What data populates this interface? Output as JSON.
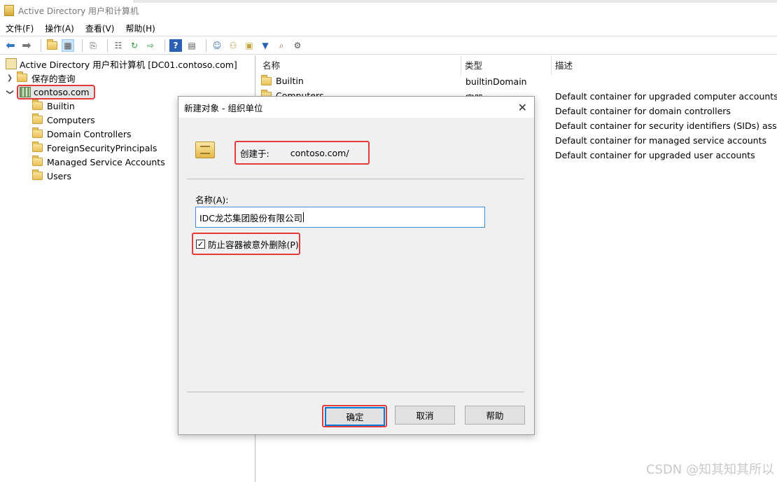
{
  "window": {
    "title": "Active Directory 用户和计算机"
  },
  "menu": [
    "文件(F)",
    "操作(A)",
    "查看(V)",
    "帮助(H)"
  ],
  "toolbar": [
    "back-icon",
    "forward-icon",
    "up-folder-icon",
    "console-tree-icon",
    "copy-icon",
    "properties-icon",
    "refresh-icon",
    "export-icon",
    "help-icon",
    "show-hide-icon",
    "new-user-icon",
    "new-group-icon",
    "new-ou-icon",
    "filter-icon",
    "find-icon",
    "delegate-icon"
  ],
  "tree": {
    "root": "Active Directory 用户和计算机 [DC01.contoso.com]",
    "saved_queries": "保存的查询",
    "domain": "contoso.com",
    "children": [
      "Builtin",
      "Computers",
      "Domain Controllers",
      "ForeignSecurityPrincipals",
      "Managed Service Accounts",
      "Users"
    ]
  },
  "list": {
    "columns": [
      "名称",
      "类型",
      "描述"
    ],
    "rows": [
      {
        "name": "Builtin",
        "type": "builtinDomain",
        "desc": ""
      },
      {
        "name": "Computers",
        "type": "容器",
        "desc": "Default container for upgraded computer accounts"
      },
      {
        "name": "",
        "type": "",
        "desc": "Default container for domain controllers"
      },
      {
        "name": "",
        "type": "",
        "desc": "Default container for security identifiers (SIDs) associat"
      },
      {
        "name": "",
        "type": "",
        "desc": "Default container for managed service accounts"
      },
      {
        "name": "",
        "type": "",
        "desc": "Default container for upgraded user accounts"
      }
    ]
  },
  "dialog": {
    "title": "新建对象 - 组织单位",
    "created_in_label": "创建于:",
    "created_in_value": "contoso.com/",
    "name_label": "名称(A):",
    "name_value": "IDC龙芯集团股份有限公司",
    "protect_label": "防止容器被意外删除(P)",
    "protect_checked": true,
    "ok": "确定",
    "cancel": "取消",
    "help": "帮助"
  },
  "watermark": "CSDN @知其知其所以",
  "colors": {
    "highlight": "#e53a3a",
    "accent": "#0078d7"
  }
}
